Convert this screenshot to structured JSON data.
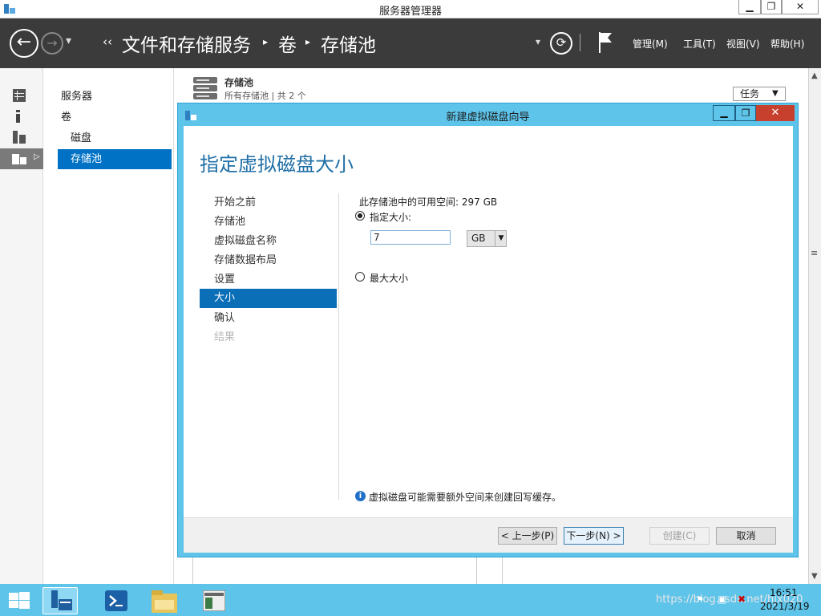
{
  "window": {
    "title": "服务器管理器",
    "minimize": "▁",
    "maximize": "❐",
    "close": "✕"
  },
  "toolbar": {
    "back_glyph": "←",
    "forward_glyph": "→",
    "dropdown_glyph": "▾",
    "breadcrumb_sep": "‹‹",
    "breadcrumb": [
      "文件和存储服务",
      "卷",
      "存储池"
    ],
    "crumb_arrow": "▸",
    "menus": [
      "管理(M)",
      "工具(T)",
      "视图(V)",
      "帮助(H)"
    ]
  },
  "nav": {
    "items": [
      {
        "label": "服务器",
        "indent": false,
        "selected": false
      },
      {
        "label": "卷",
        "indent": false,
        "selected": false
      },
      {
        "label": "磁盘",
        "indent": true,
        "selected": false
      },
      {
        "label": "存储池",
        "indent": true,
        "selected": true
      }
    ]
  },
  "pool_header": {
    "title": "存储池",
    "subtitle": "所有存储池 | 共 2 个",
    "tasks_label": "任务"
  },
  "dialog": {
    "title": "新建虚拟磁盘向导",
    "heading": "指定虚拟磁盘大小",
    "steps": [
      {
        "label": "开始之前",
        "state": "normal"
      },
      {
        "label": "存储池",
        "state": "normal"
      },
      {
        "label": "虚拟磁盘名称",
        "state": "normal"
      },
      {
        "label": "存储数据布局",
        "state": "normal"
      },
      {
        "label": "设置",
        "state": "normal"
      },
      {
        "label": "大小",
        "state": "active"
      },
      {
        "label": "确认",
        "state": "normal"
      },
      {
        "label": "结果",
        "state": "disabled"
      }
    ],
    "available_space": "此存储池中的可用空间: 297 GB",
    "specify_size_label": "指定大小:",
    "size_value": "7",
    "unit": "GB",
    "max_size_label": "最大大小",
    "info_text": "虚拟磁盘可能需要额外空间来创建回写缓存。",
    "buttons": {
      "prev": "< 上一步(P)",
      "next": "下一步(N) >",
      "create": "创建(C)",
      "cancel": "取消"
    }
  },
  "taskbar": {
    "time": "16:51",
    "date": "2021/3/19",
    "watermark": "https://blog.csdn.net/hjx020"
  }
}
